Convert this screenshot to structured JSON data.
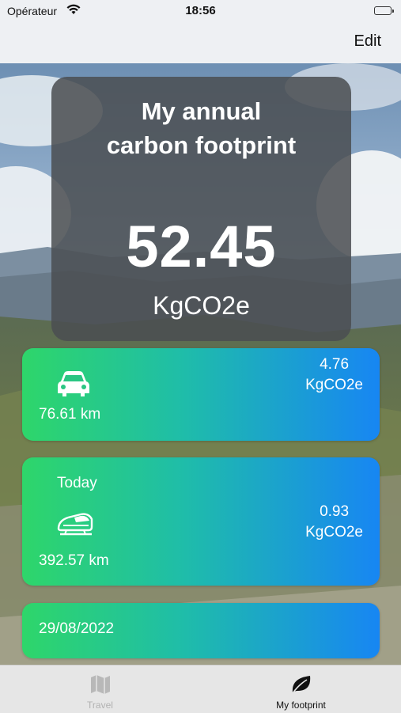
{
  "status_bar": {
    "carrier": "Opérateur",
    "time": "18:56"
  },
  "nav": {
    "edit_label": "Edit"
  },
  "summary": {
    "title_line1": "My annual",
    "title_line2": "carbon footprint",
    "value": "52.45",
    "unit": "KgCO2e"
  },
  "cards": [
    {
      "date": "",
      "icon": "car-icon",
      "distance": "76.61 km",
      "emission_value": "4.76",
      "emission_unit": "KgCO2e"
    },
    {
      "date": "Today",
      "icon": "train-icon",
      "distance": "392.57 km",
      "emission_value": "0.93",
      "emission_unit": "KgCO2e"
    },
    {
      "date": "29/08/2022"
    }
  ],
  "tabs": [
    {
      "label": "Travel",
      "icon": "map-icon",
      "selected": false
    },
    {
      "label": "My footprint",
      "icon": "leaf-icon",
      "selected": true
    }
  ],
  "colors": {
    "gradient_start": "#2ed66a",
    "gradient_end": "#1786f3",
    "panel": "#4b4e52"
  }
}
